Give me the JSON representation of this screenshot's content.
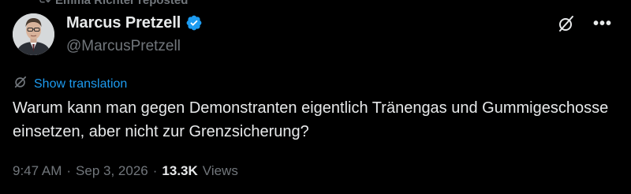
{
  "repost": {
    "text": "Emma Richter reposted"
  },
  "author": {
    "display_name": "Marcus Pretzell",
    "handle": "@MarcusPretzell",
    "verified": true
  },
  "translation": {
    "label": "Show translation"
  },
  "tweet": {
    "text": "Warum kann man gegen Demonstranten eigentlich Tränengas und Gummigeschosse einsetzen, aber nicht zur Grenzsicherung?"
  },
  "meta": {
    "time": "9:47 AM",
    "separator": "·",
    "date": "Sep 3, 2026",
    "views_count": "13.3K",
    "views_label": "Views"
  },
  "icons": {
    "repost": "repost-icon",
    "verified": "verified-badge-icon",
    "grok": "grok-icon",
    "more": "more-options-icon",
    "translate": "translate-icon"
  },
  "colors": {
    "background": "#000000",
    "text": "#e7e9ea",
    "secondary": "#71767b",
    "accent": "#1d9bf0"
  }
}
